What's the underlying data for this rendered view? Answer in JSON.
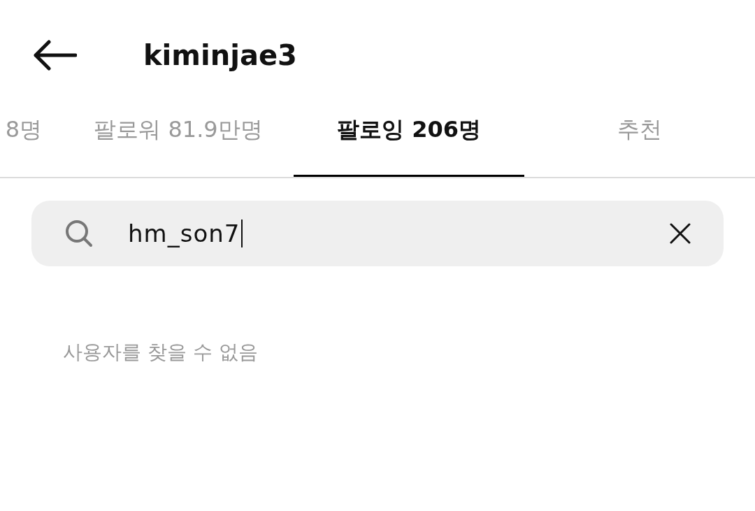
{
  "header": {
    "title": "kiminjae3"
  },
  "tabs": [
    {
      "label": "8명",
      "selected": false
    },
    {
      "label": "팔로워 81.9만명",
      "selected": false
    },
    {
      "label": "팔로잉 206명",
      "selected": true
    },
    {
      "label": "추천",
      "selected": false
    }
  ],
  "search": {
    "value": "hm_son7"
  },
  "empty_message": "사용자를 찾을 수 없음"
}
